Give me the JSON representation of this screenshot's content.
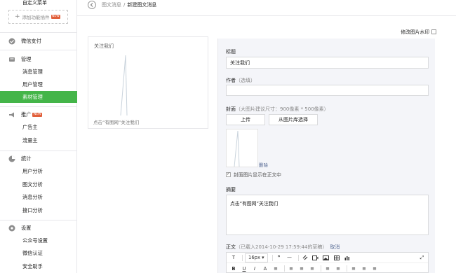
{
  "sidebar": {
    "top_item": "自定义菜单",
    "add_plugin": "添加功能插件",
    "new_badge": "NEW",
    "sections": [
      {
        "title": "微信支付",
        "icon": "payment-icon",
        "items": []
      },
      {
        "title": "管理",
        "icon": "management-icon",
        "items": [
          "消息管理",
          "用户管理",
          "素材管理"
        ]
      },
      {
        "title": "推广",
        "icon": "promotion-icon",
        "badge": "NEW",
        "items": [
          "广告主",
          "流量主"
        ]
      },
      {
        "title": "统计",
        "icon": "statistics-icon",
        "items": [
          "用户分析",
          "图文分析",
          "消息分析",
          "接口分析"
        ]
      },
      {
        "title": "设置",
        "icon": "settings-icon",
        "items": [
          "公众号设置",
          "微信认证",
          "安全助手"
        ]
      }
    ],
    "active_item": "素材管理",
    "accent_color": "#44b549"
  },
  "breadcrumb": {
    "parent": "图文消息",
    "separator": "/",
    "current": "新建图文消息"
  },
  "preview": {
    "title": "关注我们",
    "digest": "点击“有图网”关注我们"
  },
  "editor": {
    "watermark_label": "修改图片水印",
    "title_label": "标题",
    "title_value": "关注我们",
    "author_label": "作者",
    "author_hint": "（选填）",
    "author_value": "",
    "cover_label": "封面",
    "cover_hint": "（大图片建议尺寸：900像素 * 500像素）",
    "upload_button": "上传",
    "library_button": "从图片库选择",
    "delete_link": "删除",
    "show_cover_label": "封面图片显示在正文中",
    "show_cover_checked": true,
    "digest_label": "摘要",
    "digest_value": "点击“有图网”关注我们",
    "body_label": "正文",
    "body_hint": "（已载入2014-10-29 17:59:44的草稿）",
    "cancel_link": "取消"
  },
  "toolbar": {
    "row1": [
      "T",
      "16px",
      "❞",
      "—",
      "🔗",
      "▭",
      "▣",
      "▤",
      "▥"
    ],
    "font_size": "16px",
    "row2": [
      "B",
      "U",
      "I",
      "A",
      "≡",
      "≡",
      "≡",
      "≡",
      "≡",
      "≡",
      "≡",
      "≡",
      "≡"
    ],
    "fullscreen": "⤢"
  }
}
